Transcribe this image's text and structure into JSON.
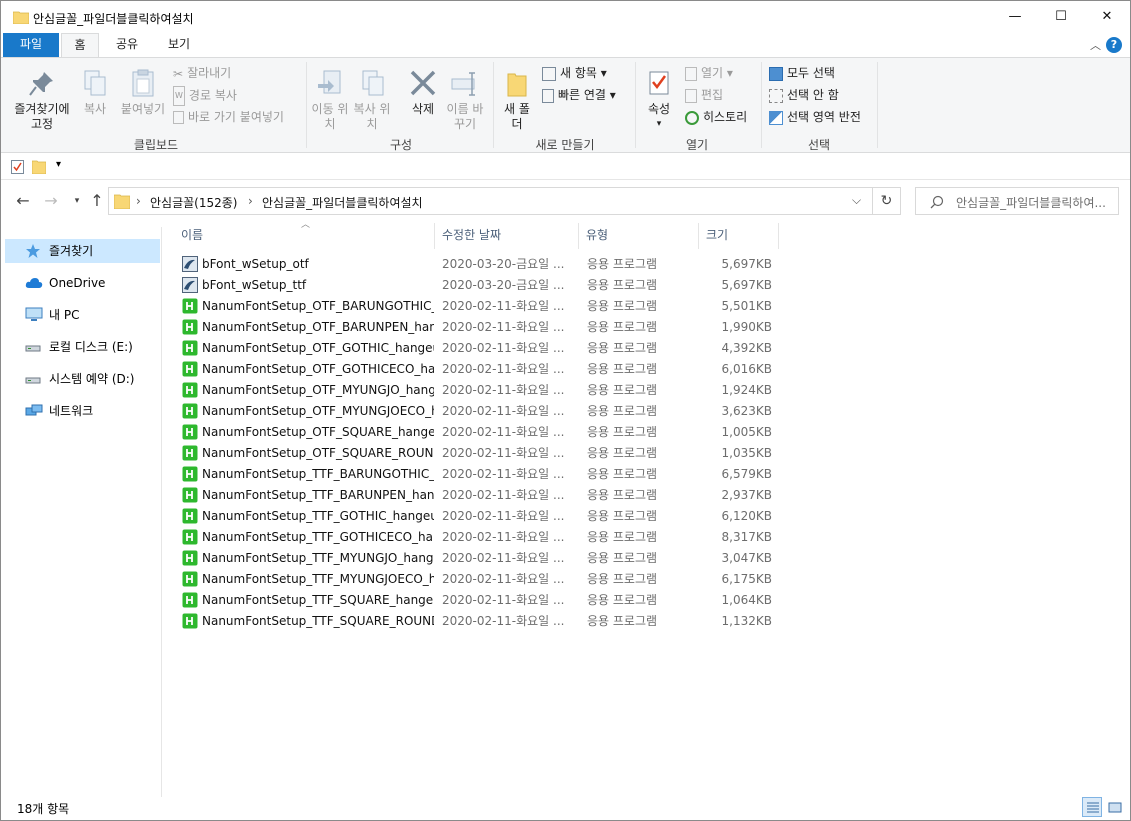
{
  "window": {
    "title": "안심글꼴_파일더블클릭하여설치",
    "minimize": "—",
    "maximize": "☐",
    "close": "✕"
  },
  "ribbon_tabs": [
    "파일",
    "홈",
    "공유",
    "보기"
  ],
  "ribbon": {
    "clipboard": {
      "pin_label": "즐겨찾기에 고정",
      "copy_label": "복사",
      "paste_label": "붙여넣기",
      "cut_label": "잘라내기",
      "copy_path_label": "경로 복사",
      "paste_shortcut_label": "바로 가기 붙여넣기",
      "group_label": "클립보드"
    },
    "organize": {
      "move_to_label": "이동 위치",
      "copy_to_label": "복사 위치",
      "delete_label": "삭제",
      "rename_label": "이름 바꾸기",
      "group_label": "구성"
    },
    "new": {
      "new_folder_label": "새 폴더",
      "new_item_label": "새 항목",
      "easy_access_label": "빠른 연결",
      "group_label": "새로 만들기"
    },
    "open": {
      "properties_label": "속성",
      "open_label": "열기",
      "edit_label": "편집",
      "history_label": "히스토리",
      "group_label": "열기"
    },
    "select": {
      "select_all_label": "모두 선택",
      "select_none_label": "선택 안 함",
      "invert_label": "선택 영역 반전",
      "group_label": "선택"
    }
  },
  "address": {
    "crumb_root": "안심글꼴(152종)",
    "crumb_current": "안심글꼴_파일더블클릭하여설치",
    "search_placeholder": "안심글꼴_파일더블클릭하여..."
  },
  "nav_pane": [
    {
      "label": "즐겨찾기",
      "icon": "star-icon"
    },
    {
      "label": "OneDrive",
      "icon": "cloud-icon"
    },
    {
      "label": "내 PC",
      "icon": "pc-icon"
    },
    {
      "label": "로컬 디스크 (E:)",
      "icon": "drive-icon"
    },
    {
      "label": "시스템 예약 (D:)",
      "icon": "drive-icon"
    },
    {
      "label": "네트워크",
      "icon": "network-icon"
    }
  ],
  "columns": {
    "name": "이름",
    "date": "수정한 날짜",
    "type": "유형",
    "size": "크기"
  },
  "files": [
    {
      "name": "bFont_wSetup_otf",
      "date": "2020-03-20-금요일 ...",
      "type": "응용 프로그램",
      "size": "5,697KB",
      "icon": "bfont-icon"
    },
    {
      "name": "bFont_wSetup_ttf",
      "date": "2020-03-20-금요일 ...",
      "type": "응용 프로그램",
      "size": "5,697KB",
      "icon": "bfont-icon"
    },
    {
      "name": "NanumFontSetup_OTF_BARUNGOTHIC_...",
      "date": "2020-02-11-화요일 ...",
      "type": "응용 프로그램",
      "size": "5,501KB",
      "icon": "nanum-icon"
    },
    {
      "name": "NanumFontSetup_OTF_BARUNPEN_han...",
      "date": "2020-02-11-화요일 ...",
      "type": "응용 프로그램",
      "size": "1,990KB",
      "icon": "nanum-icon"
    },
    {
      "name": "NanumFontSetup_OTF_GOTHIC_hangeul...",
      "date": "2020-02-11-화요일 ...",
      "type": "응용 프로그램",
      "size": "4,392KB",
      "icon": "nanum-icon"
    },
    {
      "name": "NanumFontSetup_OTF_GOTHICECO_han...",
      "date": "2020-02-11-화요일 ...",
      "type": "응용 프로그램",
      "size": "6,016KB",
      "icon": "nanum-icon"
    },
    {
      "name": "NanumFontSetup_OTF_MYUNGJO_hang...",
      "date": "2020-02-11-화요일 ...",
      "type": "응용 프로그램",
      "size": "1,924KB",
      "icon": "nanum-icon"
    },
    {
      "name": "NanumFontSetup_OTF_MYUNGJOECO_h...",
      "date": "2020-02-11-화요일 ...",
      "type": "응용 프로그램",
      "size": "3,623KB",
      "icon": "nanum-icon"
    },
    {
      "name": "NanumFontSetup_OTF_SQUARE_hangeu...",
      "date": "2020-02-11-화요일 ...",
      "type": "응용 프로그램",
      "size": "1,005KB",
      "icon": "nanum-icon"
    },
    {
      "name": "NanumFontSetup_OTF_SQUARE_ROUN...",
      "date": "2020-02-11-화요일 ...",
      "type": "응용 프로그램",
      "size": "1,035KB",
      "icon": "nanum-icon"
    },
    {
      "name": "NanumFontSetup_TTF_BARUNGOTHIC_h...",
      "date": "2020-02-11-화요일 ...",
      "type": "응용 프로그램",
      "size": "6,579KB",
      "icon": "nanum-icon"
    },
    {
      "name": "NanumFontSetup_TTF_BARUNPEN_hang...",
      "date": "2020-02-11-화요일 ...",
      "type": "응용 프로그램",
      "size": "2,937KB",
      "icon": "nanum-icon"
    },
    {
      "name": "NanumFontSetup_TTF_GOTHIC_hangeul...",
      "date": "2020-02-11-화요일 ...",
      "type": "응용 프로그램",
      "size": "6,120KB",
      "icon": "nanum-icon"
    },
    {
      "name": "NanumFontSetup_TTF_GOTHICECO_han...",
      "date": "2020-02-11-화요일 ...",
      "type": "응용 프로그램",
      "size": "8,317KB",
      "icon": "nanum-icon"
    },
    {
      "name": "NanumFontSetup_TTF_MYUNGJO_hange...",
      "date": "2020-02-11-화요일 ...",
      "type": "응용 프로그램",
      "size": "3,047KB",
      "icon": "nanum-icon"
    },
    {
      "name": "NanumFontSetup_TTF_MYUNGJOECO_h...",
      "date": "2020-02-11-화요일 ...",
      "type": "응용 프로그램",
      "size": "6,175KB",
      "icon": "nanum-icon"
    },
    {
      "name": "NanumFontSetup_TTF_SQUARE_hangeul...",
      "date": "2020-02-11-화요일 ...",
      "type": "응용 프로그램",
      "size": "1,064KB",
      "icon": "nanum-icon"
    },
    {
      "name": "NanumFontSetup_TTF_SQUARE_ROUND...",
      "date": "2020-02-11-화요일 ...",
      "type": "응용 프로그램",
      "size": "1,132KB",
      "icon": "nanum-icon"
    }
  ],
  "status": {
    "item_count": "18개 항목"
  },
  "colors": {
    "accent": "#1979ca",
    "selection": "#cce8ff",
    "nanum_green": "#2eb82e",
    "folder_yellow": "#f8d775"
  }
}
